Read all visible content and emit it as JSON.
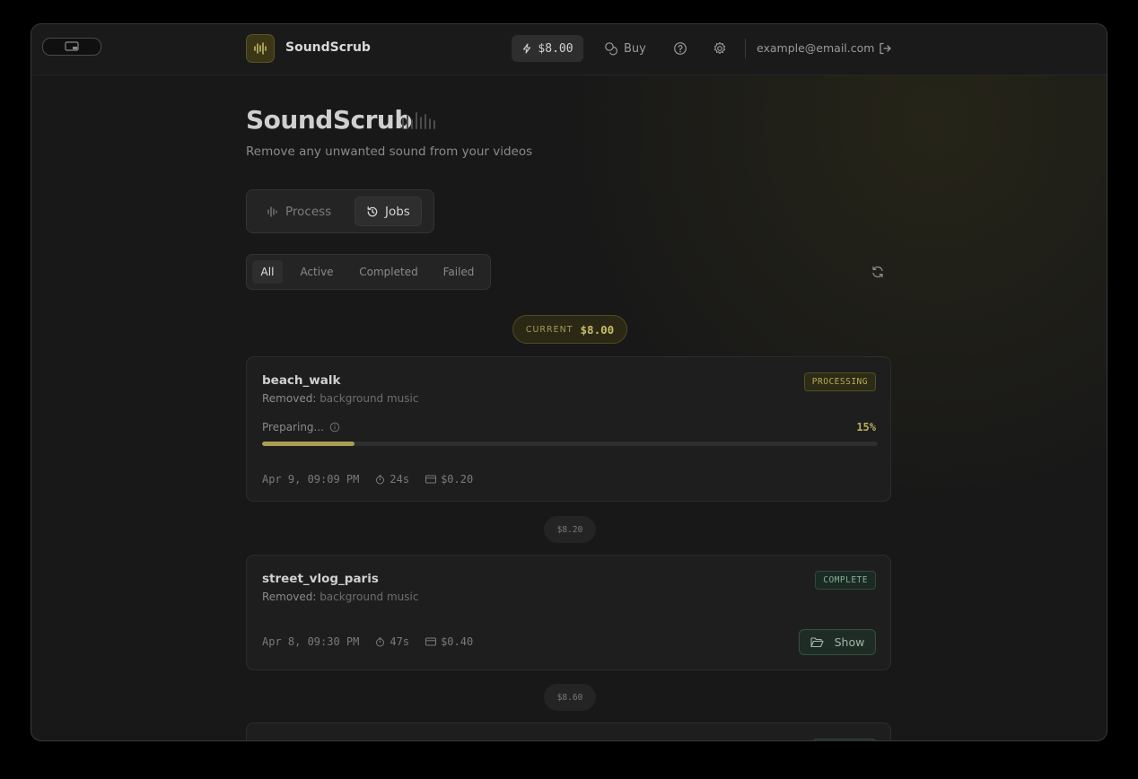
{
  "app": {
    "name": "SoundScrub",
    "title": "SoundScrub",
    "subtitle": "Remove any unwanted sound from your videos",
    "accent_color": "#c9bd6a"
  },
  "header": {
    "balance": "$8.00",
    "buy_label": "Buy",
    "email": "example@email.com"
  },
  "mode_tabs": [
    {
      "label": "Process",
      "icon": "waveform-icon",
      "active": false
    },
    {
      "label": "Jobs",
      "icon": "history-icon",
      "active": true
    }
  ],
  "filters": [
    {
      "label": "All",
      "active": true
    },
    {
      "label": "Active",
      "active": false
    },
    {
      "label": "Completed",
      "active": false
    },
    {
      "label": "Failed",
      "active": false
    }
  ],
  "current_balance": {
    "label": "CURRENT",
    "value": "$8.00"
  },
  "jobs": [
    {
      "name": "beach_walk",
      "removed_label": "Removed:",
      "removed": "background music",
      "status": "PROCESSING",
      "progress_label": "Preparing...",
      "progress_pct_text": "15%",
      "progress_fraction": 0.15,
      "date": "Apr 9, 09:09 PM",
      "duration": "24s",
      "cost": "$0.20"
    },
    {
      "name": "street_vlog_paris",
      "removed_label": "Removed:",
      "removed": "background music",
      "status": "COMPLETE",
      "date": "Apr 8, 09:30 PM",
      "duration": "47s",
      "cost": "$0.40",
      "action_label": "Show"
    }
  ],
  "balance_markers": [
    "$8.20",
    "$8.60"
  ]
}
